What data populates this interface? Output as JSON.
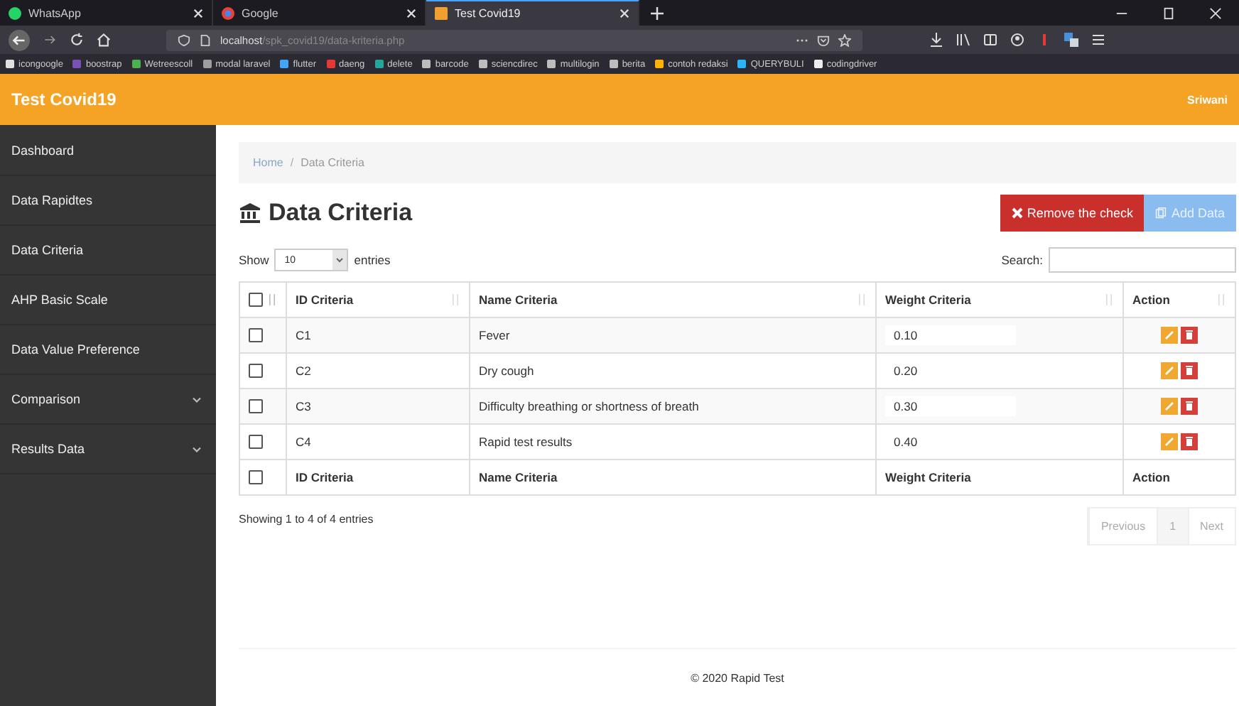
{
  "browser": {
    "tabs": [
      {
        "title": "WhatsApp",
        "selected": false
      },
      {
        "title": "Google",
        "selected": false
      },
      {
        "title": "Test Covid19",
        "selected": true
      }
    ],
    "url_host": "localhost",
    "url_path": "/spk_covid19/data-kriteria.php",
    "bookmarks": [
      {
        "label": "icongoogle",
        "color": "#e0e0e0"
      },
      {
        "label": "boostrap",
        "color": "#7952b3"
      },
      {
        "label": "Wetreescoll",
        "color": "#4caf50"
      },
      {
        "label": "modal laravel",
        "color": "#9e9e9e"
      },
      {
        "label": "flutter",
        "color": "#42a5f5"
      },
      {
        "label": "daeng",
        "color": "#e53935"
      },
      {
        "label": "delete",
        "color": "#26a69a"
      },
      {
        "label": "barcode",
        "color": "#bdbdbd"
      },
      {
        "label": "sciencdirec",
        "color": "#bdbdbd"
      },
      {
        "label": "multilogin",
        "color": "#bdbdbd"
      },
      {
        "label": "berita",
        "color": "#bdbdbd"
      },
      {
        "label": "contoh redaksi",
        "color": "#ffb300"
      },
      {
        "label": "QUERYBULI",
        "color": "#29b6f6"
      },
      {
        "label": "codingdriver",
        "color": "#eeeeee"
      }
    ]
  },
  "app": {
    "brand": "Test Covid19",
    "user": "Sriwani"
  },
  "sidebar": {
    "items": [
      {
        "label": "Dashboard",
        "kind": "link"
      },
      {
        "label": "Data Rapidtes",
        "kind": "link"
      },
      {
        "label": "Data Criteria",
        "kind": "link"
      },
      {
        "label": "AHP Basic Scale",
        "kind": "link"
      },
      {
        "label": "Data Value Preference",
        "kind": "link"
      },
      {
        "label": "Comparison",
        "kind": "dropdown"
      },
      {
        "label": "Results Data",
        "kind": "dropdown"
      }
    ]
  },
  "breadcrumb": {
    "items": [
      "Home",
      "Data Criteria"
    ],
    "separator": "/"
  },
  "page_title": "Data Criteria",
  "buttons": {
    "remove": "Remove the check",
    "add": "Add Data"
  },
  "length": {
    "before": "Show",
    "value": "10",
    "after": "entries"
  },
  "search": {
    "label": "Search:"
  },
  "table": {
    "header_checked": false,
    "columns": [
      "ID Criteria",
      "Name Criteria",
      "Weight Criteria",
      "Action"
    ],
    "rows": [
      {
        "checked": false,
        "id": "C1",
        "name": "Fever",
        "weight": "0.10"
      },
      {
        "checked": false,
        "id": "C2",
        "name": "Dry cough",
        "weight": "0.20"
      },
      {
        "checked": false,
        "id": "C3",
        "name": "Difficulty breathing or shortness of breath",
        "weight": "0.30"
      },
      {
        "checked": false,
        "id": "C4",
        "name": "Rapid test results",
        "weight": "0.40"
      }
    ],
    "footer": {
      "checked": false,
      "columns": [
        "ID Criteria",
        "Name Criteria",
        "Weight Criteria",
        "Action"
      ]
    }
  },
  "info": "Showing 1 to 4 of 4 entries",
  "pagination": [
    {
      "label": "Previous",
      "kind": "nav"
    },
    {
      "label": "1",
      "kind": "page"
    },
    {
      "label": "Next",
      "kind": "nav"
    }
  ],
  "footer": "© 2020 Rapid Test"
}
